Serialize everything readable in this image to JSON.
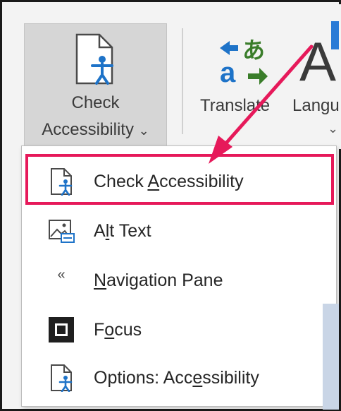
{
  "ribbon": {
    "check_accessibility": {
      "line1": "Check",
      "line2": "Accessibility",
      "chevron": "⌄",
      "icon": "accessibility-document-icon"
    },
    "translate": {
      "label": "Translate",
      "icon": "translate-icon"
    },
    "language": {
      "label": "Langu",
      "chevron": "⌄",
      "icon": "language-icon",
      "glyph": "A"
    }
  },
  "menu": {
    "items": [
      {
        "pre": "Check ",
        "accel": "A",
        "post": "ccessibility",
        "icon": "accessibility-document-icon"
      },
      {
        "pre": "A",
        "accel": "l",
        "post": "t Text",
        "icon": "alt-text-icon"
      },
      {
        "pre": "",
        "accel": "N",
        "post": "avigation Pane",
        "icon": "navigation-pane-icon",
        "glyph": "«"
      },
      {
        "pre": "F",
        "accel": "o",
        "post": "cus",
        "icon": "focus-icon"
      },
      {
        "pre": "Options: Acc",
        "accel": "e",
        "post": "ssibility",
        "icon": "accessibility-document-icon"
      }
    ]
  },
  "colors": {
    "highlight": "#e6195a",
    "accent": "#1e73c8",
    "ribbon_bg": "#f3f3f3"
  }
}
